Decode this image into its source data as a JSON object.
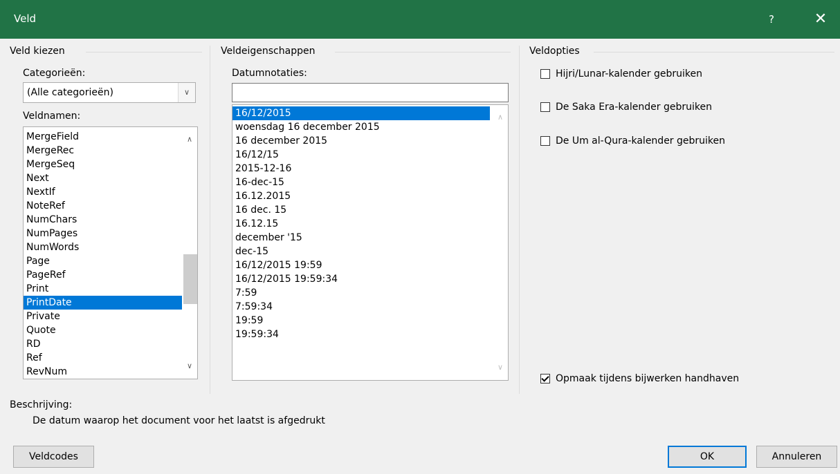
{
  "window": {
    "title": "Veld",
    "help_label": "?",
    "close_label": "✕"
  },
  "left": {
    "group_title": "Veld kiezen",
    "categories_label": "Categorieën:",
    "categories_value": "(Alle categorieën)",
    "fieldnames_label": "Veldnamen:",
    "fieldnames": [
      "MergeField",
      "MergeRec",
      "MergeSeq",
      "Next",
      "NextIf",
      "NoteRef",
      "NumChars",
      "NumPages",
      "NumWords",
      "Page",
      "PageRef",
      "Print",
      "PrintDate",
      "Private",
      "Quote",
      "RD",
      "Ref",
      "RevNum"
    ],
    "selected_field": "PrintDate"
  },
  "middle": {
    "group_title": "Veldeigenschappen",
    "formats_label": "Datumnotaties:",
    "format_input_value": "",
    "formats": [
      "16/12/2015",
      "woensdag 16 december 2015",
      "16 december 2015",
      "16/12/15",
      "2015-12-16",
      "16-dec-15",
      "16.12.2015",
      "16 dec. 15",
      "16.12.15",
      "december '15",
      "dec-15",
      "16/12/2015 19:59",
      "16/12/2015 19:59:34",
      "7:59",
      "7:59:34",
      "19:59",
      "19:59:34"
    ],
    "selected_format": "16/12/2015"
  },
  "right": {
    "group_title": "Veldopties",
    "options": [
      {
        "label": "Hijri/Lunar-kalender gebruiken",
        "checked": false
      },
      {
        "label": "De Saka Era-kalender gebruiken",
        "checked": false
      },
      {
        "label": "De Um al-Qura-kalender gebruiken",
        "checked": false
      }
    ],
    "preserve_label": "Opmaak tijdens bijwerken handhaven",
    "preserve_checked": true
  },
  "description": {
    "label": "Beschrijving:",
    "text": "De datum waarop het document voor het laatst is afgedrukt"
  },
  "buttons": {
    "field_codes": "Veldcodes",
    "ok": "OK",
    "cancel": "Annuleren"
  },
  "colors": {
    "titlebar": "#217346",
    "selection": "#0078d7"
  }
}
